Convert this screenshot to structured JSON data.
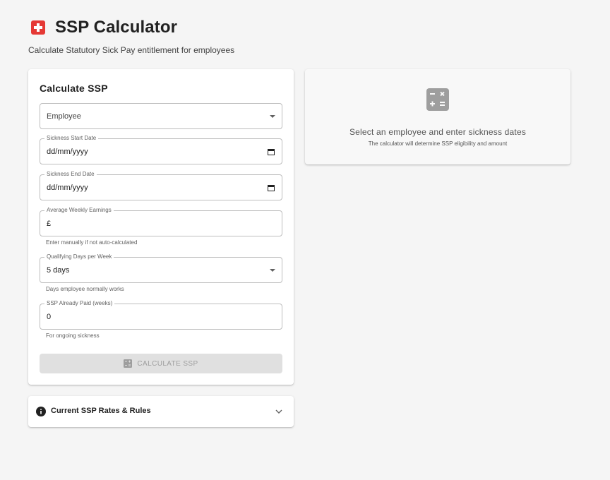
{
  "header": {
    "title": "SSP Calculator",
    "subtitle": "Calculate Statutory Sick Pay entitlement for employees",
    "icon": "medical-cross-icon",
    "accent_color": "#e53935"
  },
  "form": {
    "title": "Calculate SSP",
    "employee": {
      "placeholder": "Employee",
      "value": ""
    },
    "sickness_start": {
      "label": "Sickness Start Date",
      "value": "dd/mm/yyyy"
    },
    "sickness_end": {
      "label": "Sickness End Date",
      "value": "dd/mm/yyyy"
    },
    "weekly_earnings": {
      "label": "Average Weekly Earnings",
      "prefix": "£",
      "helper": "Enter manually if not auto-calculated"
    },
    "qualifying_days": {
      "label": "Qualifying Days per Week",
      "value": "5 days",
      "helper": "Days employee normally works"
    },
    "ssp_paid": {
      "label": "SSP Already Paid (weeks)",
      "value": "0",
      "helper": "For ongoing sickness"
    },
    "calculate_button": {
      "label": "CALCULATE SSP",
      "disabled": true
    }
  },
  "rates": {
    "title": "Current SSP Rates & Rules",
    "icon": "info-icon"
  },
  "empty_state": {
    "icon": "calculator-icon",
    "title": "Select an employee and enter sickness dates",
    "subtitle": "The calculator will determine SSP eligibility and amount"
  }
}
